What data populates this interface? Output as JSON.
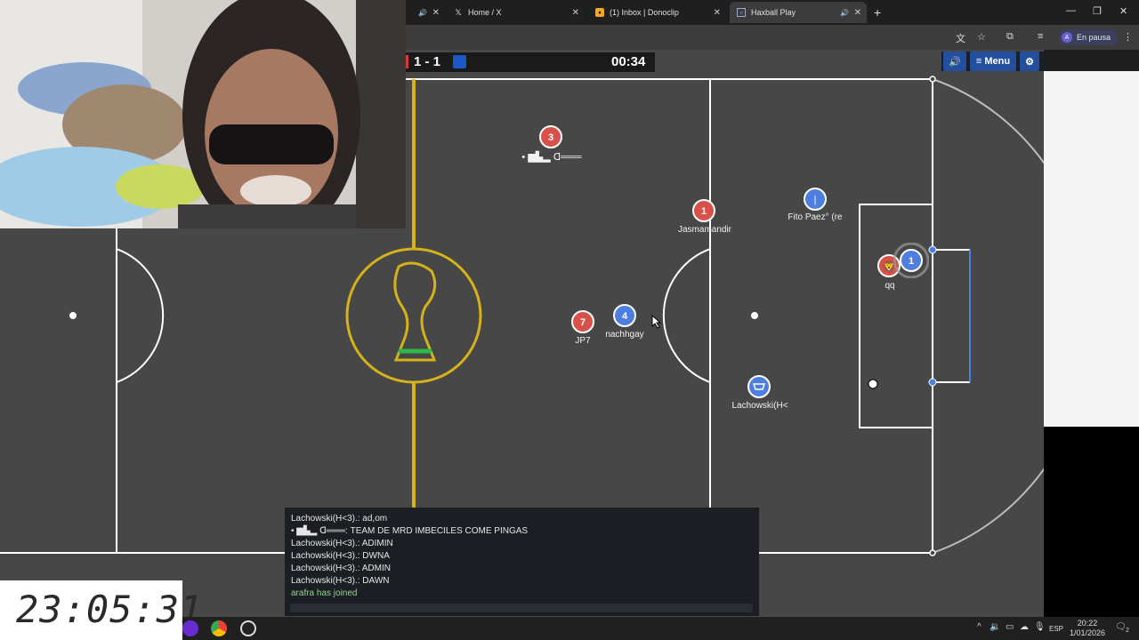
{
  "browser": {
    "tabs": [
      {
        "label": "Home / X",
        "icon": "x-logo-icon"
      },
      {
        "label": "(1) Inbox | Donoclip",
        "icon": "donoclip-icon"
      },
      {
        "label": "Haxball Play",
        "icon": "haxball-icon"
      }
    ],
    "profile": {
      "initial": "A",
      "label": "En pausa"
    }
  },
  "game": {
    "score_red": "1",
    "score_sep": "-",
    "score_blue": "1",
    "score_text": "1 - 1",
    "timer": "00:34",
    "menu_label": "≡ Menu",
    "colors": {
      "red": "#d8504a",
      "blue": "#4f7fde",
      "pitch": "#474747",
      "lines": "#ffffff",
      "gold": "#d6b21a"
    },
    "players": [
      {
        "name": "",
        "avatar": "3",
        "team": "red"
      },
      {
        "name": "Jasmamandir",
        "avatar": "1",
        "team": "red"
      },
      {
        "name": "Fito Paez° (re",
        "avatar": "|",
        "team": "blue"
      },
      {
        "name": "qq",
        "avatar": "🦁",
        "team": "red"
      },
      {
        "name": "",
        "avatar": "1",
        "team": "blue"
      },
      {
        "name": "JP7",
        "avatar": "7",
        "team": "red"
      },
      {
        "name": "nachhgay",
        "avatar": "4",
        "team": "blue"
      },
      {
        "name": "Lachowski(H<",
        "avatar": "☗",
        "team": "blue"
      }
    ]
  },
  "chat": {
    "lines": [
      "Lachowski(H<3).: ad,om",
      "• ▆▙▂ ᗡ═══: TEAM DE MRD IMBECILES COME PINGAS",
      "Lachowski(H<3).: ADIMIN",
      "Lachowski(H<3).: DWNA",
      "Lachowski(H<3).: ADMIN",
      "Lachowski(H<3).: DAWN"
    ],
    "system": "arafra has joined"
  },
  "overlay_clock": "23:05:31",
  "taskbar": {
    "lang": "ESP",
    "time": "20:22",
    "date": "1/01/2026",
    "notif": "2"
  }
}
